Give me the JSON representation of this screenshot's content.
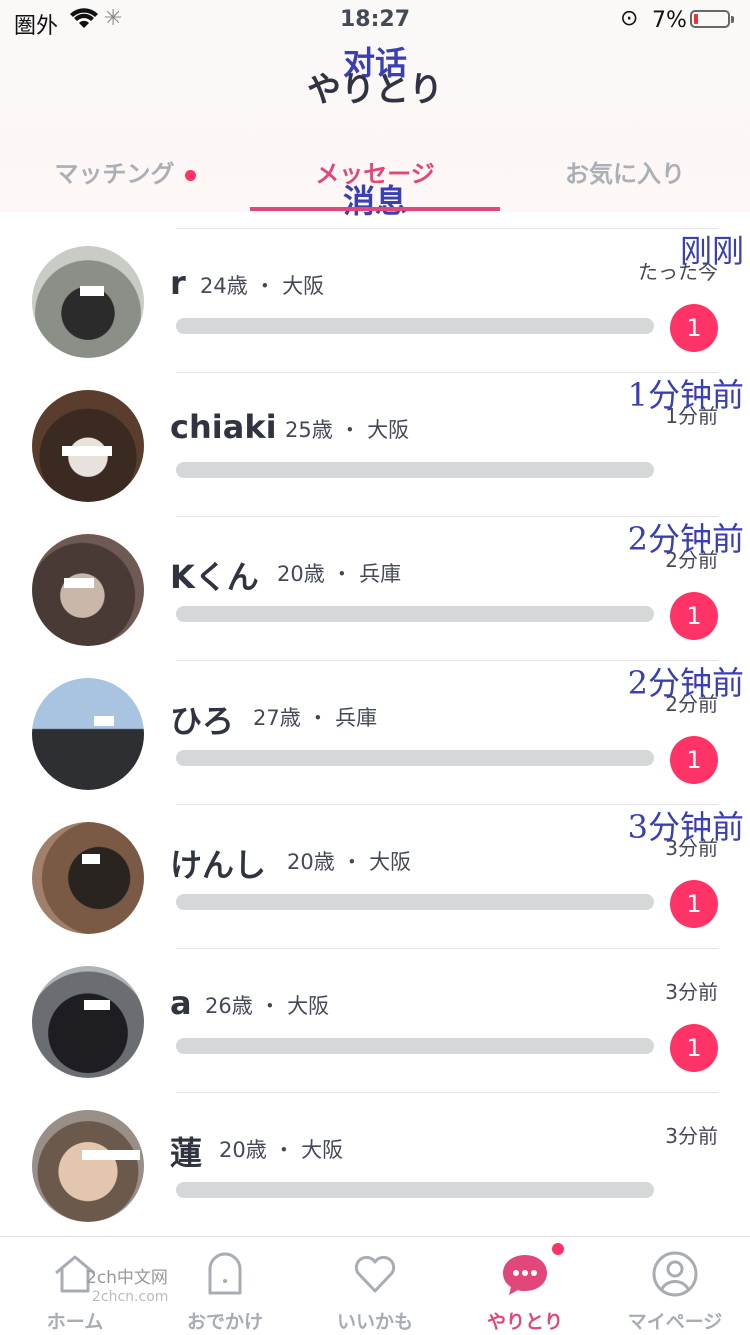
{
  "status": {
    "carrier": "圏外",
    "time": "18:27",
    "battery": "7%"
  },
  "header": {
    "title": "やりとり",
    "title_annotation": "对话"
  },
  "tabs": [
    {
      "label": "マッチング",
      "has_dot": true
    },
    {
      "label": "メッセージ",
      "active": true,
      "annotation": "消息"
    },
    {
      "label": "お気に入り"
    }
  ],
  "conversations": [
    {
      "name": "r",
      "age": "24歳",
      "place": "大阪",
      "time": "たった今",
      "time_annotation": "刚刚",
      "unread": "1"
    },
    {
      "name": "chiaki",
      "age": "25歳",
      "place": "大阪",
      "time": "1分前",
      "time_annotation": "1分钟前",
      "unread": ""
    },
    {
      "name": "Kくん",
      "age": "20歳",
      "place": "兵庫",
      "time": "2分前",
      "time_annotation": "2分钟前",
      "unread": "1"
    },
    {
      "name": "ひろ",
      "age": "27歳",
      "place": "兵庫",
      "time": "2分前",
      "time_annotation": "2分钟前",
      "unread": "1"
    },
    {
      "name": "けんし",
      "age": "20歳",
      "place": "大阪",
      "time": "3分前",
      "time_annotation": "3分钟前",
      "unread": "1"
    },
    {
      "name": "a",
      "age": "26歳",
      "place": "大阪",
      "time": "3分前",
      "time_annotation": "",
      "unread": "1"
    },
    {
      "name": "蓮",
      "age": "20歳",
      "place": "大阪",
      "time": "3分前",
      "time_annotation": "",
      "unread": ""
    }
  ],
  "bottom_nav": [
    {
      "label": "ホーム",
      "icon": "home-icon"
    },
    {
      "label": "おでかけ",
      "icon": "ghost-icon"
    },
    {
      "label": "いいかも",
      "icon": "heart-icon"
    },
    {
      "label": "やりとり",
      "icon": "chat-bubble-icon",
      "active": true
    },
    {
      "label": "マイページ",
      "icon": "user-icon"
    }
  ],
  "watermark": {
    "line1": "2ch中文网",
    "line2": "2chcn.com"
  },
  "colors": {
    "accent": "#e1477a",
    "badge": "#ff3366",
    "annotation": "#3a40b3"
  }
}
